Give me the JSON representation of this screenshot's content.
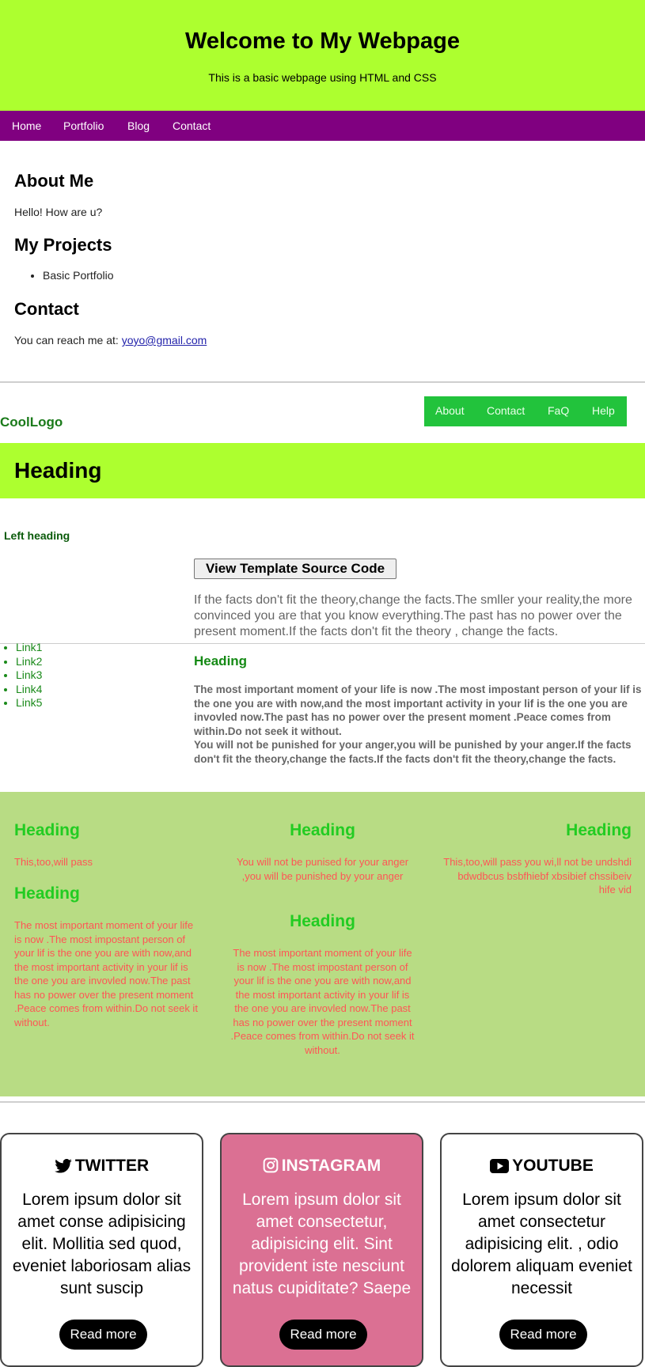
{
  "header": {
    "title": "Welcome to My Webpage",
    "subtitle": "This is a basic webpage using HTML and CSS"
  },
  "nav": {
    "items": [
      "Home",
      "Portfolio",
      "Blog",
      "Contact"
    ]
  },
  "about": {
    "heading": "About Me",
    "text": "Hello! How are u?"
  },
  "projects": {
    "heading": "My Projects",
    "items": [
      "Basic Portfolio"
    ]
  },
  "contact": {
    "heading": "Contact",
    "text": "You can reach me at:",
    "email": "yoyo@gmail.com"
  },
  "coolnav": {
    "logo": "CoolLogo",
    "items": [
      "About",
      "Contact",
      "FaQ",
      "Help"
    ]
  },
  "band": {
    "heading": "Heading"
  },
  "left": {
    "heading": "Left heading",
    "links": [
      "Link1",
      "Link2",
      "Link3",
      "Link4",
      "Link5"
    ]
  },
  "template": {
    "button": "View Template Source Code",
    "quote": "If the facts don't fit the theory,change the facts.The smller your reality,the more convinced you are that you know everything.The past has no power over the present moment.If the facts don't fit the theory , change the facts.",
    "heading": "Heading",
    "para1": "The most important moment of your life is now .The most impostant person of your lif is the one you are with now,and the most important activity in your lif is the one you are invovled now.The past has no power over the present moment .Peace comes from within.Do not seek it without.",
    "para2": "You will not be punished for your anger,you will be punished by your anger.If the facts don't fit the theory,change the facts.If the facts don't fit the theory,change the facts."
  },
  "green": {
    "col1": {
      "h1": "Heading",
      "p1": "This,too,will pass",
      "h2": "Heading",
      "p2": "The most important moment of your life is now .The most impostant person of your lif is the one you are with now,and the most important activity in your lif is the one you are invovled now.The past has no power over the present moment .Peace comes from within.Do not seek it without."
    },
    "col2": {
      "h1": "Heading",
      "p1": "You will not be punised for your anger ,you will be punished by your anger",
      "h2": "Heading",
      "p2": "The most important moment of your life is now .The most impostant person of your lif is the one you are with now,and the most important activity in your lif is the one you are invovled now.The past has no power over the present moment .Peace comes from within.Do not seek it without."
    },
    "col3": {
      "h1": "Heading",
      "p1": "This,too,will pass you wi,ll not be undshdi bdwdbcus bsbfhiebf xbsibief chssibeiv hife vid"
    }
  },
  "cards": [
    {
      "title": "TWITTER",
      "icon": "twitter-icon",
      "text": "Lorem ipsum dolor sit amet conse adipisicing elit. Mollitia sed quod, eveniet laboriosam alias sunt suscip",
      "button": "Read more"
    },
    {
      "title": "INSTAGRAM",
      "icon": "instagram-icon",
      "text": "Lorem ipsum dolor sit amet consectetur, adipisicing elit. Sint provident iste nesciunt natus cupiditate? Saepe",
      "button": "Read more",
      "bg": "#db7093"
    },
    {
      "title": "YOUTUBE",
      "icon": "youtube-icon",
      "text": "Lorem ipsum dolor sit amet consectetur adipisicing elit. , odio dolorem aliquam eveniet necessit",
      "button": "Read more"
    }
  ],
  "colors": {
    "lime": "#adff2f",
    "purple": "#800080",
    "green_nav": "#22c33c",
    "panel": "#b8dc84",
    "pink": "#db7093"
  }
}
